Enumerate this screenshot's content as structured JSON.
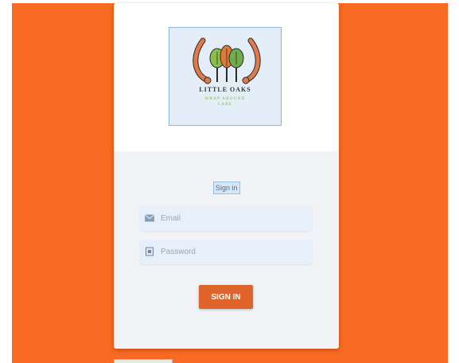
{
  "logo": {
    "title": "LITTLE OAKS",
    "subtitle": "WRAP AROUND CARE"
  },
  "signin": {
    "heading": "Sign in",
    "button_label": "SIGN IN"
  },
  "fields": {
    "email_placeholder": "Email",
    "password_placeholder": "Password"
  },
  "colors": {
    "background": "#f96a23",
    "button": "#e0632c",
    "card": "#f1f3f6",
    "field": "#e7f0fa"
  },
  "icons": {
    "email": "envelope-icon",
    "password": "lock-icon"
  }
}
